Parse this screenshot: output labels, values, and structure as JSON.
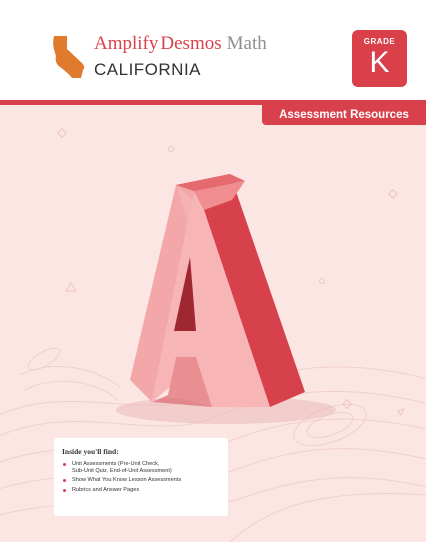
{
  "header": {
    "brand_word1": "Amplify",
    "brand_word2": "Desmos",
    "brand_word3": "Math",
    "state": "CALIFORNIA",
    "grade_label": "GRADE",
    "grade_value": "K"
  },
  "tab": {
    "label": "Assessment Resources"
  },
  "cover_art": {
    "letter_icon": "letter-a-3d-icon",
    "accent_color": "#d8414b",
    "background_color": "#fbe6e4"
  },
  "info_box": {
    "title": "Inside you'll find:",
    "items": [
      "Unit Assessments (Pre-Unit Check,\nSub-Unit Quiz, End-of-Unit Assessment)",
      "Show What You Know Lesson Assessments",
      "Rubrics and Answer Pages"
    ]
  }
}
